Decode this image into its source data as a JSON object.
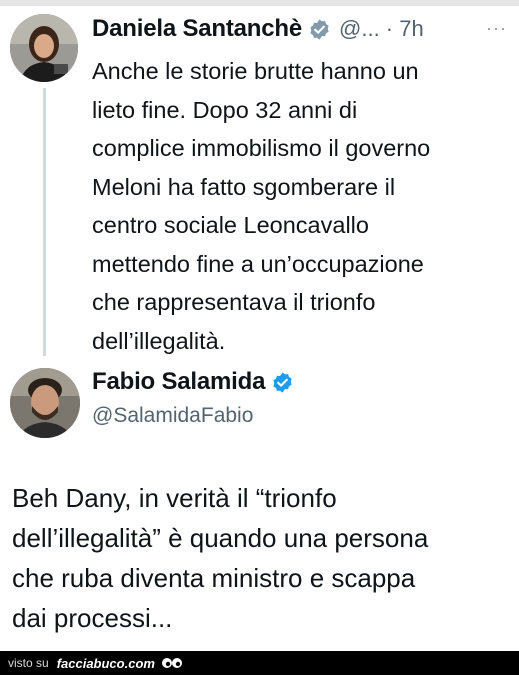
{
  "tweets": [
    {
      "author_name": "Daniela Santanchè",
      "handle_time": "@... · 7h",
      "more_label": "···",
      "text": "Anche le storie brutte hanno un\nlieto fine. Dopo 32 anni di\ncomplice immobilismo il governo\nMeloni ha fatto sgomberare il\ncentro sociale Leoncavallo\nmettendo fine a un’occupazione\nche rappresentava il trionfo\ndell’illegalità.",
      "verified_badge": "verified-gray-icon"
    },
    {
      "author_name": "Fabio Salamida",
      "handle": "@SalamidaFabio",
      "text": "Beh Dany, in verità il “trionfo\ndell’illegalità” è quando una persona\nche ruba diventa ministro e scappa\ndai processi...",
      "verified_badge": "verified-blue-icon"
    }
  ],
  "footer": {
    "visto_su": "visto su",
    "site": "facciabuco.com"
  },
  "colors": {
    "text": "#0f1419",
    "secondary": "#536471",
    "verified_blue": "#1d9bf0",
    "verified_gray": "#829aab",
    "thread_line": "#cfd9de"
  }
}
